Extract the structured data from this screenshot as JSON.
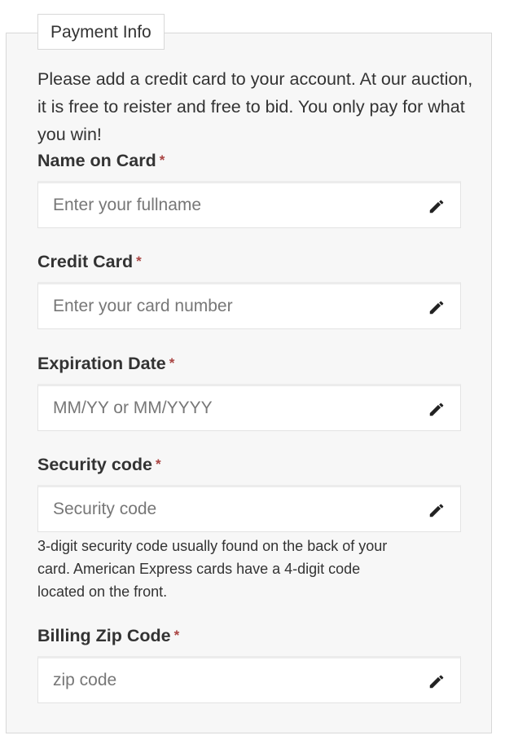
{
  "form": {
    "legend": "Payment Info",
    "intro": "Please add a credit card to your account. At our auction, it is free to reister and free to bid. You only pay for what you win!",
    "required_marker": "*",
    "fields": {
      "name": {
        "label": "Name on Card",
        "placeholder": "Enter your fullname",
        "icon": "pencil-icon"
      },
      "card": {
        "label": "Credit Card",
        "placeholder": "Enter your card number",
        "icon": "pencil-icon"
      },
      "expiry": {
        "label": "Expiration Date",
        "placeholder": "MM/YY or MM/YYYY",
        "icon": "pencil-icon"
      },
      "security": {
        "label": "Security code",
        "placeholder": "Security code",
        "icon": "pencil-icon",
        "help": "3-digit security code usually found on the back of your card. American Express cards have a 4-digit code located on the front."
      },
      "zip": {
        "label": "Billing Zip Code",
        "placeholder": "zip code",
        "icon": "pencil-icon"
      }
    }
  },
  "colors": {
    "required": "#a94442",
    "panel_bg": "#f7f7f7",
    "border": "#d8d8d8",
    "placeholder": "#777777"
  }
}
